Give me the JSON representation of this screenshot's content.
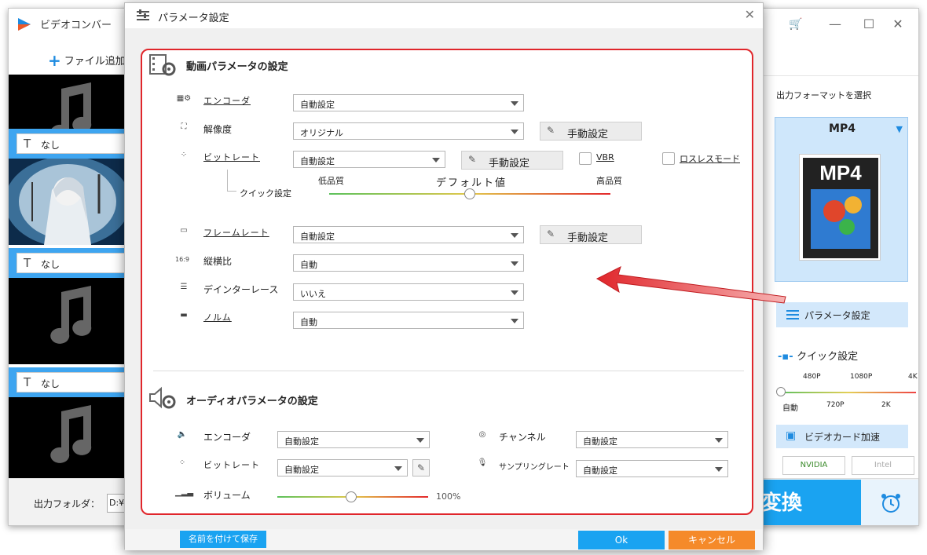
{
  "app": {
    "title": "ビデオコンバー",
    "add_file": "ファイル追加",
    "items": [
      {
        "subtitle": "なし"
      },
      {
        "subtitle": "なし"
      },
      {
        "subtitle": "なし"
      }
    ],
    "output_folder_label": "出力フォルダ：",
    "output_folder_value": "D:¥f"
  },
  "right_panel": {
    "format_title": "出力フォーマットを選択",
    "format_name": "MP4",
    "format_icon_text": "MP4",
    "param_button": "パラメータ設定",
    "quick_title": "クイック設定",
    "quick_labels_top": [
      "480P",
      "1080P",
      "4K"
    ],
    "quick_labels_bottom": [
      "自動",
      "720P",
      "2K"
    ],
    "gpu_button": "ビデオカード加速",
    "vendors": [
      "NVIDIA",
      "Intel"
    ],
    "convert": "変換"
  },
  "dialog": {
    "title": "パラメータ設定",
    "video": {
      "section_title": "動画パラメータの設定",
      "encoder": {
        "label": "エンコーダ",
        "value": "自動設定"
      },
      "resolution": {
        "label": "解像度",
        "value": "オリジナル",
        "button": "手動設定"
      },
      "bitrate": {
        "label": "ビットレート",
        "value": "自動設定",
        "button": "手動設定",
        "vbr": "VBR",
        "lossless": "ロスレスモード"
      },
      "quick": {
        "label": "クイック設定",
        "low": "低品質",
        "default": "デフォルト値",
        "high": "高品質",
        "value": 0.5
      },
      "framerate": {
        "label": "フレームレート",
        "value": "自動設定",
        "button": "手動設定"
      },
      "aspect": {
        "label": "縦横比",
        "value": "自動",
        "icon_text": "16:9"
      },
      "deinterlace": {
        "label": "デインターレース",
        "value": "いいえ"
      },
      "norm": {
        "label": "ノルム",
        "value": "自動"
      }
    },
    "audio": {
      "section_title": "オーディオパラメータの設定",
      "encoder": {
        "label": "エンコーダ",
        "value": "自動設定"
      },
      "bitrate": {
        "label": "ビットレート",
        "value": "自動設定"
      },
      "channel": {
        "label": "チャンネル",
        "value": "自動設定"
      },
      "samplerate": {
        "label": "サンプリングレート",
        "value": "自動設定"
      },
      "volume": {
        "label": "ボリューム",
        "value": "100%",
        "level": 0.49
      }
    },
    "footer": {
      "save_as": "名前を付けて保存",
      "ok": "Ok",
      "cancel": "キャンセル"
    }
  },
  "colors": {
    "accent": "#1aa3f1",
    "highlight_frame": "#e0262b",
    "cancel": "#f58a2a"
  }
}
